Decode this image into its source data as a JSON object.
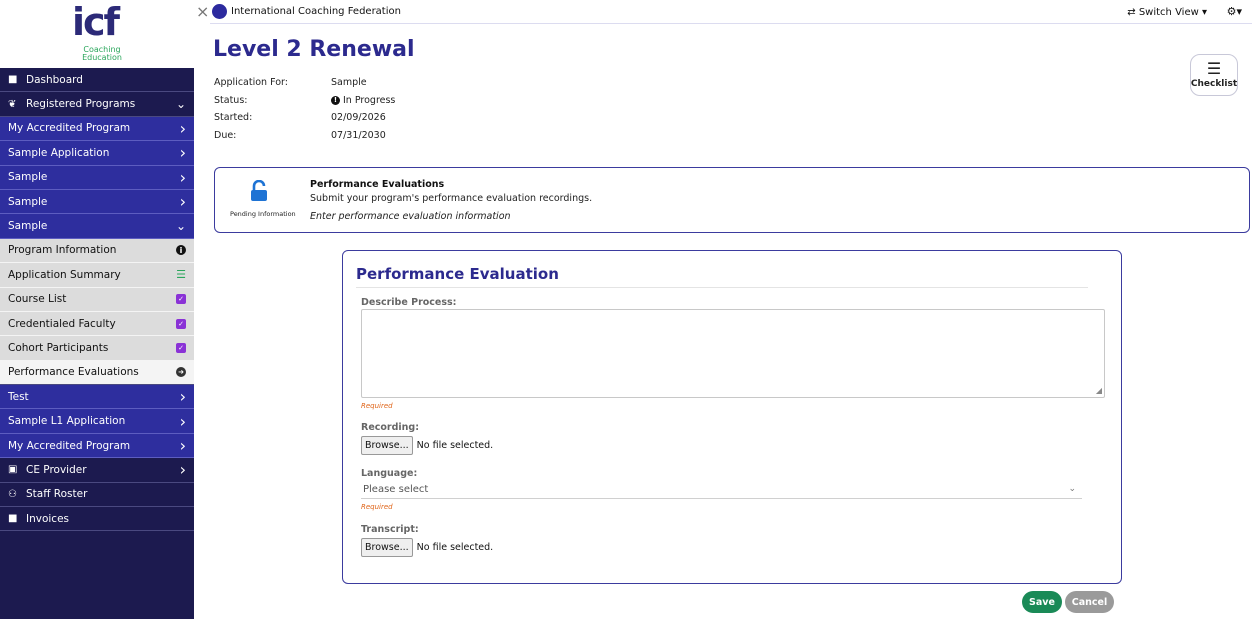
{
  "logo": {
    "mark": "icf",
    "sub_line1": "Coaching",
    "sub_line2": "Education"
  },
  "sidebar": {
    "items": [
      {
        "label": "Dashboard",
        "icon": "building-icon",
        "glyph": "■",
        "style": "dark",
        "trail": ""
      },
      {
        "label": "Registered Programs",
        "icon": "users-icon",
        "glyph": "❦",
        "style": "dark",
        "trail": "chevron-down"
      },
      {
        "label": "My Accredited Program",
        "style": "blue",
        "trail": "chevron-right"
      },
      {
        "label": "Sample Application",
        "style": "blue",
        "trail": "chevron-right"
      },
      {
        "label": "Sample",
        "style": "blue",
        "trail": "chevron-right"
      },
      {
        "label": "Sample",
        "style": "blue",
        "trail": "chevron-right"
      },
      {
        "label": "Sample",
        "style": "blue",
        "trail": "chevron-down"
      },
      {
        "label": "Program Information",
        "style": "light",
        "trail": "info"
      },
      {
        "label": "Application Summary",
        "style": "light",
        "trail": "list"
      },
      {
        "label": "Course List",
        "style": "light",
        "trail": "check"
      },
      {
        "label": "Credentialed Faculty",
        "style": "light",
        "trail": "check"
      },
      {
        "label": "Cohort Participants",
        "style": "light",
        "trail": "check"
      },
      {
        "label": "Performance Evaluations",
        "style": "active",
        "trail": "arrow"
      },
      {
        "label": "Test",
        "style": "blue",
        "trail": "chevron-right"
      },
      {
        "label": "Sample L1 Application",
        "style": "blue",
        "trail": "chevron-right"
      },
      {
        "label": "My Accredited Program",
        "style": "blue",
        "trail": "chevron-right"
      },
      {
        "label": "CE Provider",
        "icon": "certificate-icon",
        "glyph": "▣",
        "style": "dark",
        "trail": "chevron-right"
      },
      {
        "label": "Staff Roster",
        "icon": "people-icon",
        "glyph": "⚇",
        "style": "dark",
        "trail": ""
      },
      {
        "label": "Invoices",
        "icon": "file-icon",
        "glyph": "■",
        "style": "dark",
        "trail": ""
      }
    ]
  },
  "topbar": {
    "org_name": "International Coaching Federation",
    "switch_view": "⇄ Switch View ▾",
    "settings": "⚙▾"
  },
  "header": {
    "title": "Level 2 Renewal",
    "meta": [
      {
        "key": "Application For:",
        "value": "Sample"
      },
      {
        "key": "Status:",
        "value": "In Progress"
      },
      {
        "key": "Started:",
        "value": "02/09/2026"
      },
      {
        "key": "Due:",
        "value": "07/31/2030"
      }
    ],
    "checklist_label": "Checklist"
  },
  "section": {
    "status": "Pending Information",
    "title": "Performance Evaluations",
    "description": "Submit your program's performance evaluation recordings.",
    "hint": "Enter performance evaluation information"
  },
  "form": {
    "title": "Performance Evaluation",
    "describe_label": "Describe Process:",
    "required_text": "Required",
    "recording_label": "Recording:",
    "browse_label": "Browse...",
    "no_file": "No file selected.",
    "language_label": "Language:",
    "language_value": "Please select",
    "transcript_label": "Transcript:"
  },
  "actions": {
    "save": "Save",
    "cancel": "Cancel"
  },
  "colors": {
    "brand": "#2c2a8e",
    "sidebar_dark": "#1c1a4f",
    "sidebar_blue": "#2e2e9e",
    "save": "#1a8a57",
    "required": "#e0661b",
    "accent_green": "#2aa65b"
  }
}
